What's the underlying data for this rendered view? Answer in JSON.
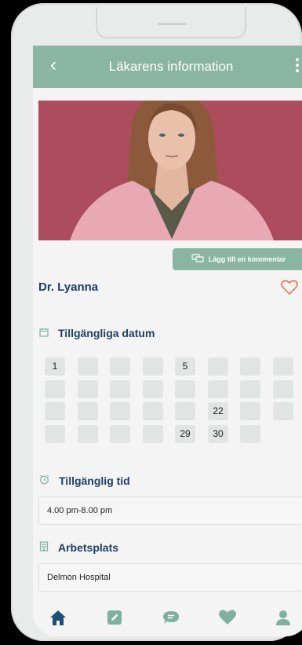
{
  "header": {
    "title": "Läkarens information"
  },
  "doctor": {
    "name": "Dr. Lyanna"
  },
  "actions": {
    "comment_label": "Lägg till en kommentar"
  },
  "sections": {
    "dates_title": "Tillgängliga datum",
    "time_title": "Tillgänglig tid",
    "work_title": "Arbetsplats"
  },
  "calendar": {
    "rows": [
      [
        "1",
        "",
        "",
        "",
        "5",
        "",
        "",
        ""
      ],
      [
        "",
        "",
        "",
        "",
        "",
        "",
        "",
        ""
      ],
      [
        "",
        "",
        "",
        "",
        "",
        "22",
        "",
        ""
      ],
      [
        "",
        "",
        "",
        "",
        "29",
        "30",
        "",
        null
      ]
    ]
  },
  "available_time": "4.00 pm-8.00 pm",
  "workplace": "Delmon Hospital",
  "colors": {
    "accent": "#8ab4a4",
    "heading": "#1e3f66",
    "heart": "#e0795a",
    "nav_icons": "#7fb0a0",
    "nav_active": "#1e4f7a"
  },
  "nav": [
    "home-icon",
    "edit-icon",
    "chat-icon",
    "heart-icon",
    "profile-icon"
  ]
}
